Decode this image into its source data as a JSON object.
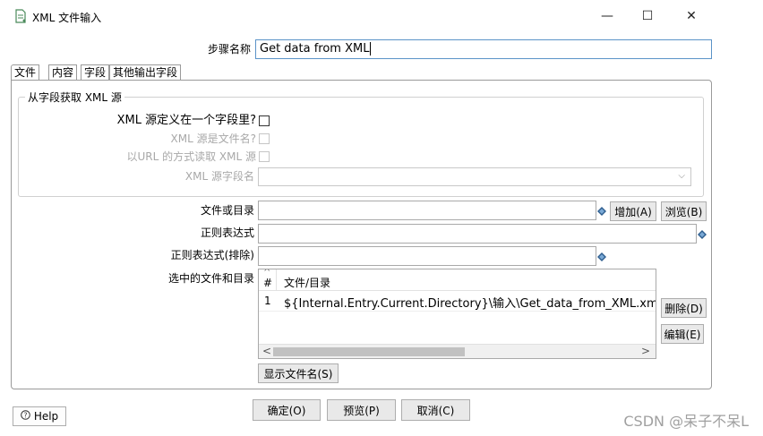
{
  "window": {
    "title": "XML 文件输入",
    "minimize": "—",
    "maximize": "☐",
    "close": "✕"
  },
  "step": {
    "label": "步骤名称",
    "value": "Get data from XML"
  },
  "tabs": [
    {
      "label": "文件"
    },
    {
      "label": "内容"
    },
    {
      "label": "字段"
    },
    {
      "label": "其他输出字段"
    }
  ],
  "xml_source_group": {
    "legend": "从字段获取 XML 源",
    "defined_in_field_label": "XML 源定义在一个字段里?",
    "is_filename_label": "XML 源是文件名?",
    "read_as_url_label": "以URL 的方式读取 XML 源",
    "field_name_label": "XML 源字段名"
  },
  "file_or_dir": {
    "label": "文件或目录",
    "value": ""
  },
  "regex": {
    "label": "正则表达式",
    "value": ""
  },
  "regex_exclude": {
    "label": "正则表达式(排除)",
    "value": ""
  },
  "buttons": {
    "add": "增加(A)",
    "browse": "浏览(B)",
    "delete": "删除(D)",
    "edit": "编辑(E)",
    "show_filenames": "显示文件名(S)",
    "ok": "确定(O)",
    "preview": "预览(P)",
    "cancel": "取消(C)",
    "help": "Help"
  },
  "selected_files": {
    "label": "选中的文件和目录",
    "columns": [
      "#",
      "文件/目录"
    ],
    "rows": [
      {
        "num": "1",
        "path": "${Internal.Entry.Current.Directory}\\输入\\Get_data_from_XML.xml"
      }
    ],
    "scroll_left": "<",
    "scroll_right": ">",
    "sort_glyph": "^"
  },
  "watermark": "CSDN @呆子不呆L",
  "colors": {
    "focus_border": "#5b93c8",
    "variable_icon": "#2f5e8f"
  }
}
